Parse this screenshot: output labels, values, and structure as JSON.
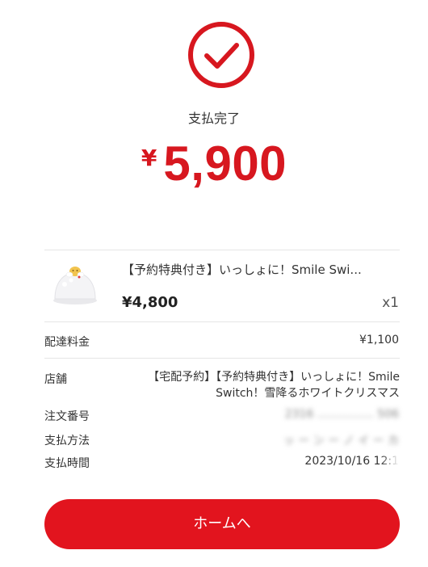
{
  "status": {
    "title": "支払完了"
  },
  "total": {
    "currency_symbol": "¥",
    "amount": "5,900"
  },
  "product": {
    "title": "【予約特典付き】いっしょに！Smile Swi...",
    "price": "¥4,800",
    "quantity": "x1"
  },
  "details": {
    "delivery_fee_label": "配達料金",
    "delivery_fee_value": "¥1,100",
    "shop_label": "店舗",
    "shop_value_line1": "【宅配予約】【予約特典付き】いっしょに！Smile",
    "shop_value_line2": "Switch！雪降るホワイトクリスマス",
    "order_number_label": "注文番号",
    "order_number_value": "2316 …………… 506",
    "payment_method_label": "支払方法",
    "payment_method_value": "ッ ー ン ー ノ イ ー カ",
    "payment_time_label": "支払時間",
    "payment_time_value": "2023/10/16 12:1"
  },
  "button": {
    "home_label": "ホームへ"
  },
  "colors": {
    "accent": "#e2141e",
    "price_red": "#d7171f"
  }
}
